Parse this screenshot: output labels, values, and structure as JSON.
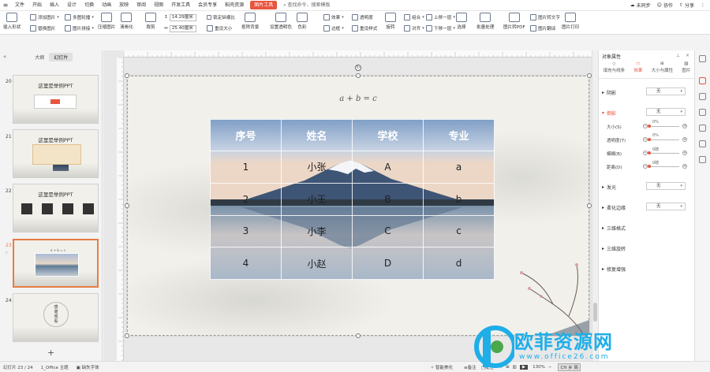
{
  "menubar": {
    "items": [
      "文件",
      "开始",
      "插入",
      "设计",
      "切换",
      "动画",
      "放映",
      "审阅",
      "视图",
      "开发工具",
      "会员专享",
      "稻壳资源",
      "图片工具"
    ],
    "active": "图片工具",
    "search": "查找命令、搜索模板",
    "sync": "未同步",
    "collab": "协作",
    "share": "分享"
  },
  "ribbon": {
    "insert_shape": "插入形状",
    "add_picture": "添加图片",
    "multi_pic": "多图轮播",
    "replace_pic": "替换图片",
    "pic_stitch": "图片拼接",
    "compress": "压缩图片",
    "sharpen": "清晰化",
    "crop": "裁剪",
    "height": "14.29厘米",
    "width": "25.40厘米",
    "lock_ratio": "锁定纵横比",
    "reset_size": "重设大小",
    "remove_bg": "抠除背景",
    "set_transparent": "设置透明色",
    "color": "色彩",
    "effect": "效果",
    "transparency": "透明度",
    "border": "边框",
    "reset_style": "重设样式",
    "rotate": "旋转",
    "group": "组合",
    "align": "对齐",
    "bring_forward": "上移一层",
    "send_backward": "下移一层",
    "select": "选择",
    "batch": "批量处理",
    "to_pdf": "图片转PDF",
    "to_text": "图片转文字",
    "translate": "图片翻译",
    "print": "图片打印"
  },
  "leftpanel": {
    "tab_outline": "大纲",
    "tab_slides": "幻灯片",
    "slides": [
      {
        "num": "20",
        "title": "这里是举例PPT"
      },
      {
        "num": "21",
        "title": "这里是举例PPT"
      },
      {
        "num": "22",
        "title": "这里是举例PPT"
      },
      {
        "num": "23",
        "title": ""
      },
      {
        "num": "24",
        "title": "感谢观看"
      }
    ],
    "add": "+"
  },
  "slide": {
    "formula": "a + b = c",
    "table": {
      "headers": [
        "序号",
        "姓名",
        "学校",
        "专业"
      ],
      "rows": [
        [
          "1",
          "小张",
          "A",
          "a"
        ],
        [
          "2",
          "小王",
          "B",
          "b"
        ],
        [
          "3",
          "小李",
          "C",
          "c"
        ],
        [
          "4",
          "小赵",
          "D",
          "d"
        ]
      ]
    }
  },
  "rightpanel": {
    "title": "对象属性",
    "tabs": [
      "填充与线条",
      "效果",
      "大小与属性",
      "图片"
    ],
    "active_tab": "效果",
    "shadow": "阴影",
    "shadow_val": "无",
    "reflection": "倒影",
    "reflection_val": "无",
    "size": "大小(S)",
    "size_val": "0%",
    "transparency": "透明度(T)",
    "transparency_val": "0%",
    "blur": "模糊(B)",
    "blur_val": "0磅",
    "distance": "距离(D)",
    "distance_val": "0磅",
    "glow": "发光",
    "glow_val": "无",
    "soft_edge": "柔化边缘",
    "soft_edge_val": "无",
    "three_d_format": "三维格式",
    "three_d_rotation": "三维旋转",
    "pic_repair": "修复增强"
  },
  "statusbar": {
    "slide_info": "幻灯片 23 / 24",
    "theme": "1_Office 主题",
    "missing_font": "缺失字体",
    "smart_beautify": "智能美化",
    "notes": "备注",
    "comments": "批注",
    "zoom": "130%",
    "ime": "CH 乡 简"
  },
  "watermark": {
    "text": "欧菲资源网",
    "url": "www.office26.com",
    "brand_color": "#1faee8"
  },
  "colors": {
    "accent": "#e9553f",
    "selection": "#e97b45"
  }
}
